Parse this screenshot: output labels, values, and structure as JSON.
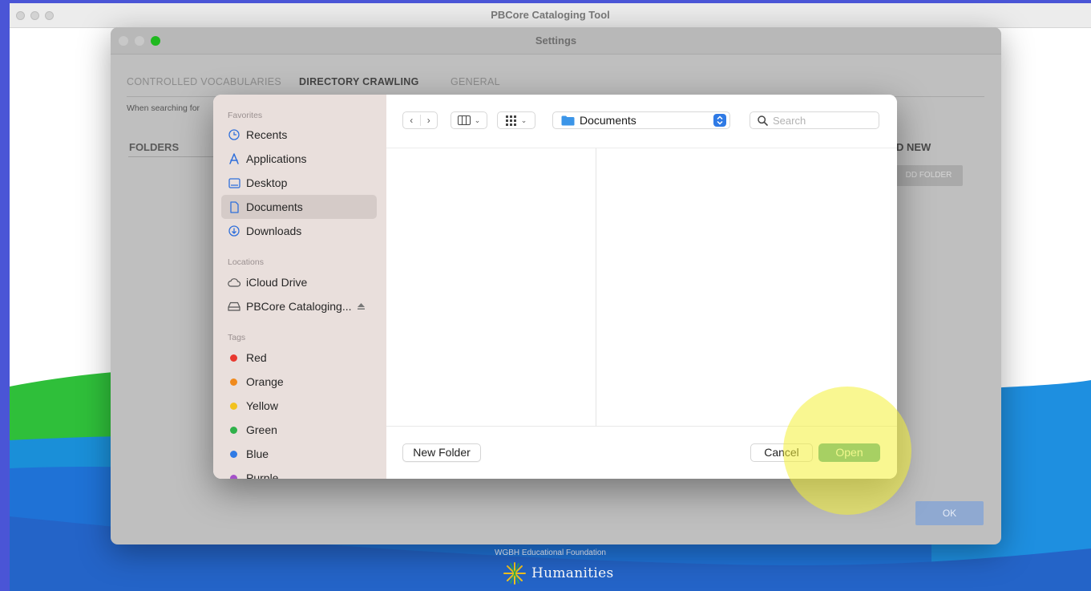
{
  "app": {
    "title": "PBCore Cataloging Tool"
  },
  "settings": {
    "title": "Settings",
    "tabs": [
      {
        "label": "CONTROLLED VOCABULARIES",
        "active": false
      },
      {
        "label": "DIRECTORY CRAWLING",
        "active": true
      },
      {
        "label": "GENERAL",
        "active": false
      }
    ],
    "description": "When searching for",
    "folders_label": "FOLDERS",
    "add_new_label": "D NEW",
    "add_folder_button": "DD FOLDER",
    "ok_button": "OK"
  },
  "dialog": {
    "sidebar": {
      "favorites_heading": "Favorites",
      "favorites": [
        {
          "label": "Recents",
          "icon": "clock-icon"
        },
        {
          "label": "Applications",
          "icon": "applications-icon"
        },
        {
          "label": "Desktop",
          "icon": "desktop-icon"
        },
        {
          "label": "Documents",
          "icon": "document-icon",
          "selected": true
        },
        {
          "label": "Downloads",
          "icon": "download-icon"
        }
      ],
      "locations_heading": "Locations",
      "locations": [
        {
          "label": "iCloud Drive",
          "icon": "cloud-icon"
        },
        {
          "label": "PBCore Cataloging...",
          "icon": "drive-icon"
        }
      ],
      "tags_heading": "Tags",
      "tags": [
        {
          "label": "Red",
          "color": "#e8382f"
        },
        {
          "label": "Orange",
          "color": "#f08a1c"
        },
        {
          "label": "Yellow",
          "color": "#f2c21e"
        },
        {
          "label": "Green",
          "color": "#2fb14a"
        },
        {
          "label": "Blue",
          "color": "#2f7ae5"
        },
        {
          "label": "Purple",
          "color": "#a551c9"
        }
      ]
    },
    "location_popup": "Documents",
    "search_placeholder": "Search",
    "new_folder_button": "New Folder",
    "cancel_button": "Cancel",
    "open_button": "Open"
  },
  "footer": {
    "organization": "WGBH Educational Foundation",
    "logo_text": "Humanities"
  },
  "colors": {
    "accent": "#2f7ae5",
    "open_button": "#4aa899",
    "highlight": "#f4f137"
  }
}
